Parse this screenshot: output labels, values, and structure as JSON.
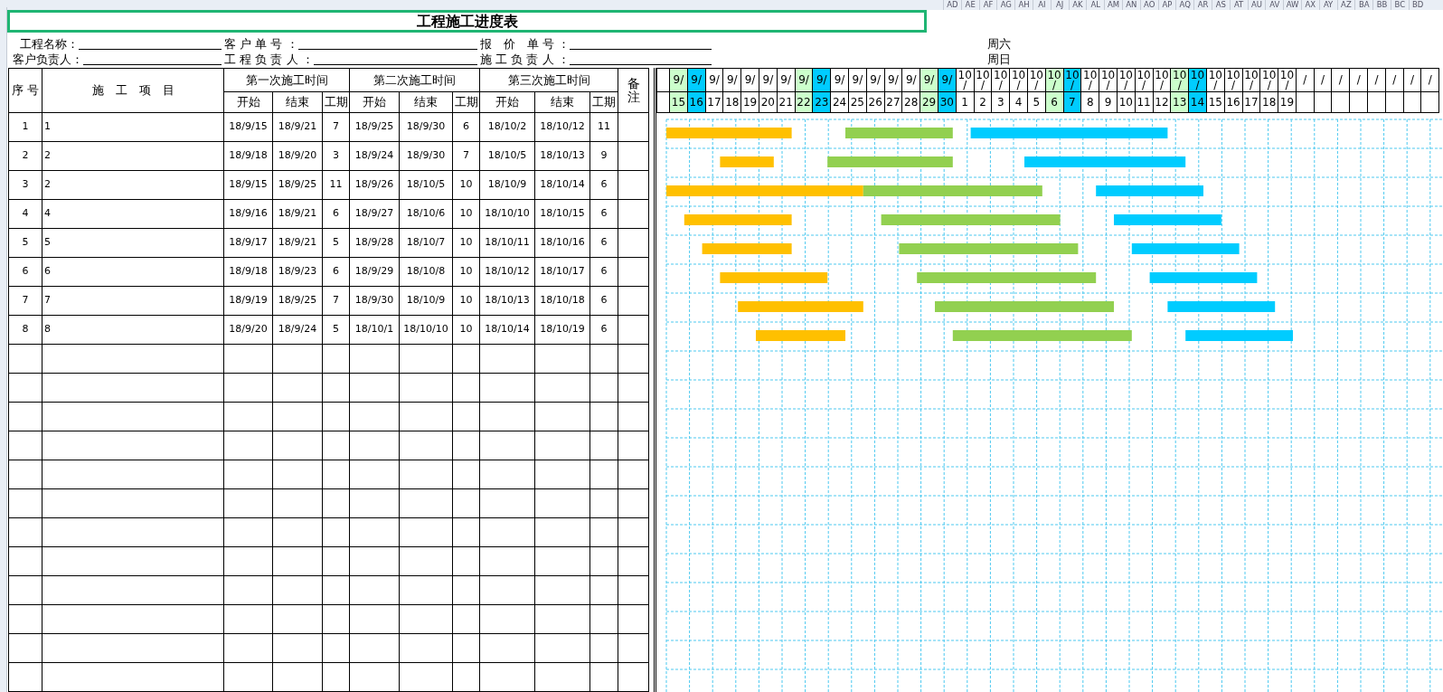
{
  "column_letters": [
    "AD",
    "AE",
    "AF",
    "AG",
    "AH",
    "AI",
    "AJ",
    "AK",
    "AL",
    "AM",
    "AN",
    "AO",
    "AP",
    "AQ",
    "AR",
    "AS",
    "AT",
    "AU",
    "AV",
    "AW",
    "AX",
    "AY",
    "AZ",
    "BA",
    "BB",
    "BC",
    "BD"
  ],
  "title": "工程施工进度表",
  "info_rows": [
    {
      "fields": [
        {
          "label": "工程名称："
        },
        {
          "label": "客 户 单 号 ："
        },
        {
          "label": "报　价　单 号 ："
        }
      ],
      "weekday": "周六"
    },
    {
      "fields": [
        {
          "label": "客户负责人："
        },
        {
          "label": "工 程 负 责 人 ："
        },
        {
          "label": "施 工 负 责 人 ："
        }
      ],
      "weekday": "周日"
    }
  ],
  "table": {
    "index_heading": "序 号",
    "item_heading": "施　工　项　目",
    "remarks_heading": "备注",
    "phase_groups": [
      {
        "label": "第一次施工时间",
        "color": "#ffc000",
        "subheadings": [
          "开始",
          "结束",
          "工期"
        ]
      },
      {
        "label": "第二次施工时间",
        "color": "#92d050",
        "subheadings": [
          "开始",
          "结束",
          "工期"
        ]
      },
      {
        "label": "第三次施工时间",
        "color": "#00ccff",
        "subheadings": [
          "开始",
          "结束",
          "工期"
        ]
      }
    ],
    "rows": [
      {
        "index": "1",
        "item": "1",
        "phases": [
          [
            "18/9/15",
            "18/9/21",
            "7"
          ],
          [
            "18/9/25",
            "18/9/30",
            "6"
          ],
          [
            "18/10/2",
            "18/10/12",
            "11"
          ]
        ]
      },
      {
        "index": "2",
        "item": "2",
        "phases": [
          [
            "18/9/18",
            "18/9/20",
            "3"
          ],
          [
            "18/9/24",
            "18/9/30",
            "7"
          ],
          [
            "18/10/5",
            "18/10/13",
            "9"
          ]
        ]
      },
      {
        "index": "3",
        "item": "2",
        "phases": [
          [
            "18/9/15",
            "18/9/25",
            "11"
          ],
          [
            "18/9/26",
            "18/10/5",
            "10"
          ],
          [
            "18/10/9",
            "18/10/14",
            "6"
          ]
        ]
      },
      {
        "index": "4",
        "item": "4",
        "phases": [
          [
            "18/9/16",
            "18/9/21",
            "6"
          ],
          [
            "18/9/27",
            "18/10/6",
            "10"
          ],
          [
            "18/10/10",
            "18/10/15",
            "6"
          ]
        ]
      },
      {
        "index": "5",
        "item": "5",
        "phases": [
          [
            "18/9/17",
            "18/9/21",
            "5"
          ],
          [
            "18/9/28",
            "18/10/7",
            "10"
          ],
          [
            "18/10/11",
            "18/10/16",
            "6"
          ]
        ]
      },
      {
        "index": "6",
        "item": "6",
        "phases": [
          [
            "18/9/18",
            "18/9/23",
            "6"
          ],
          [
            "18/9/29",
            "18/10/8",
            "10"
          ],
          [
            "18/10/12",
            "18/10/17",
            "6"
          ]
        ]
      },
      {
        "index": "7",
        "item": "7",
        "phases": [
          [
            "18/9/19",
            "18/9/25",
            "7"
          ],
          [
            "18/9/30",
            "18/10/9",
            "10"
          ],
          [
            "18/10/13",
            "18/10/18",
            "6"
          ]
        ]
      },
      {
        "index": "8",
        "item": "8",
        "phases": [
          [
            "18/9/20",
            "18/9/24",
            "5"
          ],
          [
            "18/10/1",
            "18/10/10",
            "10"
          ],
          [
            "18/10/14",
            "18/10/19",
            "6"
          ]
        ]
      }
    ]
  },
  "timeline": [
    {
      "month_lines": [
        "9/"
      ],
      "day": "15",
      "kind": "saturday"
    },
    {
      "month_lines": [
        "9/"
      ],
      "day": "16",
      "kind": "sunday"
    },
    {
      "month_lines": [
        "9/"
      ],
      "day": "17",
      "kind": "weekday"
    },
    {
      "month_lines": [
        "9/"
      ],
      "day": "18",
      "kind": "weekday"
    },
    {
      "month_lines": [
        "9/"
      ],
      "day": "19",
      "kind": "weekday"
    },
    {
      "month_lines": [
        "9/"
      ],
      "day": "20",
      "kind": "weekday"
    },
    {
      "month_lines": [
        "9/"
      ],
      "day": "21",
      "kind": "weekday"
    },
    {
      "month_lines": [
        "9/"
      ],
      "day": "22",
      "kind": "saturday"
    },
    {
      "month_lines": [
        "9/"
      ],
      "day": "23",
      "kind": "sunday"
    },
    {
      "month_lines": [
        "9/"
      ],
      "day": "24",
      "kind": "weekday"
    },
    {
      "month_lines": [
        "9/"
      ],
      "day": "25",
      "kind": "weekday"
    },
    {
      "month_lines": [
        "9/"
      ],
      "day": "26",
      "kind": "weekday"
    },
    {
      "month_lines": [
        "9/"
      ],
      "day": "27",
      "kind": "weekday"
    },
    {
      "month_lines": [
        "9/"
      ],
      "day": "28",
      "kind": "weekday"
    },
    {
      "month_lines": [
        "9/"
      ],
      "day": "29",
      "kind": "saturday"
    },
    {
      "month_lines": [
        "9/"
      ],
      "day": "30",
      "kind": "sunday"
    },
    {
      "month_lines": [
        "10",
        "/"
      ],
      "day": "1",
      "kind": "weekday"
    },
    {
      "month_lines": [
        "10",
        "/"
      ],
      "day": "2",
      "kind": "weekday"
    },
    {
      "month_lines": [
        "10",
        "/"
      ],
      "day": "3",
      "kind": "weekday"
    },
    {
      "month_lines": [
        "10",
        "/"
      ],
      "day": "4",
      "kind": "weekday"
    },
    {
      "month_lines": [
        "10",
        "/"
      ],
      "day": "5",
      "kind": "weekday"
    },
    {
      "month_lines": [
        "10",
        "/"
      ],
      "day": "6",
      "kind": "saturday"
    },
    {
      "month_lines": [
        "10",
        "/"
      ],
      "day": "7",
      "kind": "sunday"
    },
    {
      "month_lines": [
        "10",
        "/"
      ],
      "day": "8",
      "kind": "weekday"
    },
    {
      "month_lines": [
        "10",
        "/"
      ],
      "day": "9",
      "kind": "weekday"
    },
    {
      "month_lines": [
        "10",
        "/"
      ],
      "day": "10",
      "kind": "weekday"
    },
    {
      "month_lines": [
        "10",
        "/"
      ],
      "day": "11",
      "kind": "weekday"
    },
    {
      "month_lines": [
        "10",
        "/"
      ],
      "day": "12",
      "kind": "weekday"
    },
    {
      "month_lines": [
        "10",
        "/"
      ],
      "day": "13",
      "kind": "saturday"
    },
    {
      "month_lines": [
        "10",
        "/"
      ],
      "day": "14",
      "kind": "sunday"
    },
    {
      "month_lines": [
        "10",
        "/"
      ],
      "day": "15",
      "kind": "weekday"
    },
    {
      "month_lines": [
        "10",
        "/"
      ],
      "day": "16",
      "kind": "weekday"
    },
    {
      "month_lines": [
        "10",
        "/"
      ],
      "day": "17",
      "kind": "weekday"
    },
    {
      "month_lines": [
        "10",
        "/"
      ],
      "day": "18",
      "kind": "weekday"
    },
    {
      "month_lines": [
        "10",
        "/"
      ],
      "day": "19",
      "kind": "weekday"
    },
    {
      "month_lines": [
        "/"
      ],
      "kind": "weekday"
    },
    {
      "month_lines": [
        "/"
      ],
      "kind": "weekday"
    },
    {
      "month_lines": [
        "/"
      ],
      "kind": "weekday"
    },
    {
      "month_lines": [
        "/"
      ],
      "kind": "weekday"
    },
    {
      "month_lines": [
        "/"
      ],
      "kind": "weekday"
    },
    {
      "month_lines": [
        "/"
      ],
      "kind": "weekday"
    },
    {
      "month_lines": [
        "/"
      ],
      "kind": "weekday"
    },
    {
      "month_lines": [
        "/"
      ],
      "kind": "weekday"
    }
  ]
}
